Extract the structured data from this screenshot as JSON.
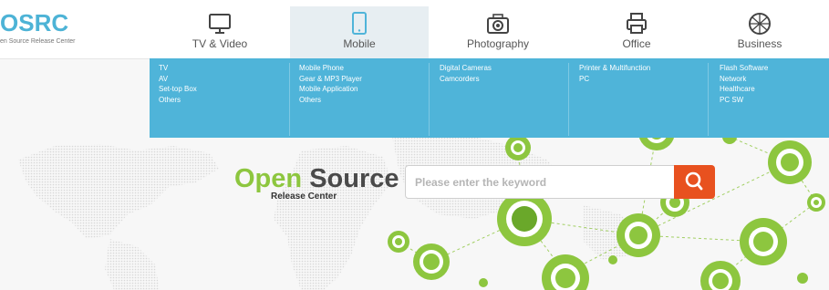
{
  "logo": {
    "brand": "OSRC",
    "subtitle": "en Source Release Center"
  },
  "nav": [
    {
      "label": "TV & Video",
      "icon": "tv-icon"
    },
    {
      "label": "Mobile",
      "icon": "mobile-icon",
      "active": true
    },
    {
      "label": "Photography",
      "icon": "camera-icon"
    },
    {
      "label": "Office",
      "icon": "printer-icon"
    },
    {
      "label": "Business",
      "icon": "globe-icon"
    }
  ],
  "menu": {
    "tv": [
      "TV",
      "AV",
      "Set-top Box",
      "Others"
    ],
    "mobile": [
      "Mobile Phone",
      "Gear & MP3 Player",
      "Mobile Application",
      "Others"
    ],
    "photography": [
      "Digital Cameras",
      "Camcorders"
    ],
    "office": [
      "Printer & Multifunction",
      "PC"
    ],
    "business": [
      "Flash Software",
      "Network",
      "Healthcare",
      "PC SW"
    ]
  },
  "brand": {
    "title_green": "Open",
    "title_dark": "Source",
    "subtitle": "Release Center"
  },
  "search": {
    "placeholder": "Please enter the keyword",
    "button_icon": "search-icon"
  },
  "colors": {
    "accent_blue": "#4fb4d9",
    "menu_blue": "#4fb4d9",
    "green": "#8dc63f",
    "search_orange": "#e8511f",
    "active_tab": "#e7eef2"
  }
}
